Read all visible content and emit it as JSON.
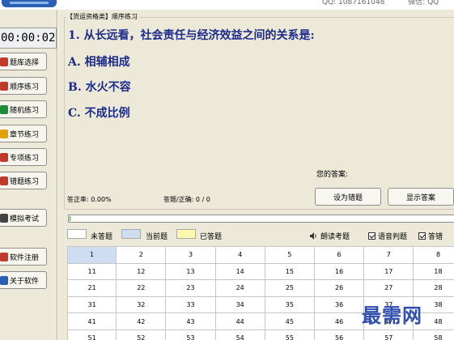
{
  "header": {
    "qq": "QQ: 1087161048",
    "wechat": "微信: QQ"
  },
  "timer": "00:00:02",
  "sidebar": {
    "items": [
      {
        "label": "题库选择",
        "icon": "book-icon",
        "color": "#c0392b"
      },
      {
        "label": "顺序练习",
        "icon": "list-icon",
        "color": "#c0392b"
      },
      {
        "label": "随机练习",
        "icon": "random-icon",
        "color": "#1e8b3a"
      },
      {
        "label": "章节练习",
        "icon": "chapter-icon",
        "color": "#e0a000"
      },
      {
        "label": "专项练习",
        "icon": "topic-icon",
        "color": "#c0392b"
      },
      {
        "label": "错题练习",
        "icon": "wrong-icon",
        "color": "#c0392b"
      },
      {
        "label": "模拟考试",
        "icon": "exam-icon",
        "color": "#444444"
      },
      {
        "label": "软件注册",
        "icon": "register-icon",
        "color": "#c0392b"
      },
      {
        "label": "关于软件",
        "icon": "about-icon",
        "color": "#2b5fb5"
      }
    ]
  },
  "category": "【货运资格类】顺序练习",
  "question": {
    "title": "1. 从长远看，社会责任与经济效益之间的关系是:",
    "options": [
      "A. 相辅相成",
      "B. 水火不容",
      "C. 不成比例"
    ]
  },
  "answer_label": "您的答案:",
  "stats": {
    "accuracy": "答正率: 0.00%",
    "answered": "答题/正确: 0 / 0"
  },
  "buttons": {
    "mark_wrong": "设为错题",
    "show_answer": "显示答案"
  },
  "progress": 0.0,
  "legend": [
    {
      "label": "未答题",
      "color": "#ffffff"
    },
    {
      "label": "当前题",
      "color": "#cfddf2"
    },
    {
      "label": "已答题",
      "color": "#fdf7b0"
    }
  ],
  "options": {
    "read_aloud": "朗读考题",
    "voice_judge": "语音判题",
    "auto_answer": "答错"
  },
  "grid": {
    "current": 1,
    "rows": [
      [
        "1",
        "2",
        "3",
        "4",
        "5",
        "6",
        "7",
        "8"
      ],
      [
        "11",
        "12",
        "13",
        "14",
        "15",
        "16",
        "17",
        "18"
      ],
      [
        "21",
        "22",
        "23",
        "24",
        "25",
        "26",
        "27",
        "28"
      ],
      [
        "31",
        "32",
        "33",
        "34",
        "35",
        "36",
        "37",
        "38"
      ],
      [
        "41",
        "42",
        "43",
        "44",
        "45",
        "46",
        "47",
        "48"
      ],
      [
        "51",
        "52",
        "53",
        "54",
        "55",
        "56",
        "57",
        "58"
      ]
    ]
  },
  "watermark": "最需网"
}
